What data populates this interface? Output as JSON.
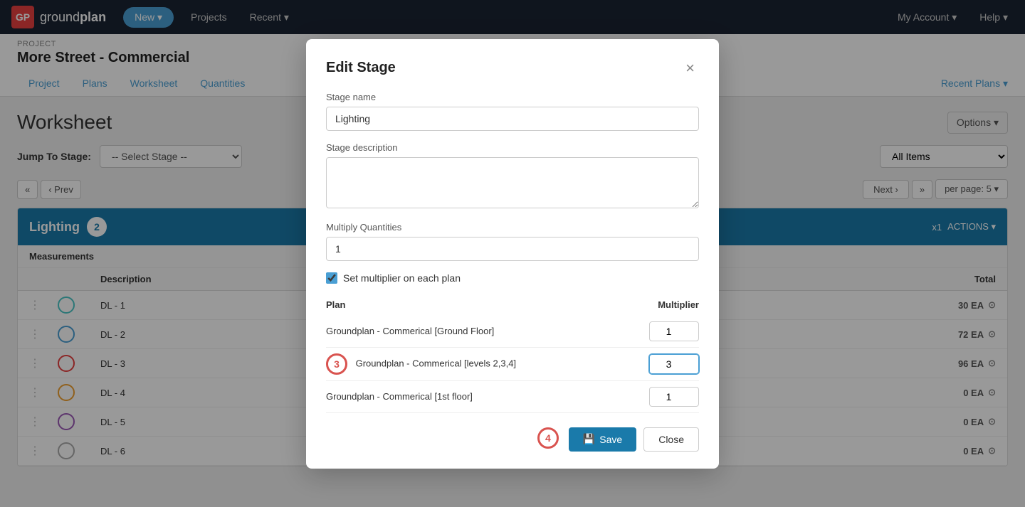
{
  "app": {
    "logo_text_ground": "ground",
    "logo_text_plan": "plan",
    "logo_icon": "GP"
  },
  "top_nav": {
    "new_label": "New ▾",
    "projects_label": "Projects",
    "recent_label": "Recent ▾",
    "account_label": "My Account ▾",
    "help_label": "Help ▾"
  },
  "project": {
    "label": "PROJECT",
    "name": "More Street - Commercial",
    "tabs": [
      "Project",
      "Plans",
      "Worksheet",
      "Quantities"
    ],
    "recent_plans": "Recent Plans ▾"
  },
  "worksheet": {
    "title": "Worksheet",
    "options": "Options ▾",
    "jump_label": "Jump To Stage:",
    "jump_placeholder": "-- Select Stage --",
    "pagination": {
      "prev_skip": "«",
      "prev": "‹ Prev",
      "next": "Next ›",
      "next_skip": "»",
      "per_page": "per page: 5 ▾"
    }
  },
  "stage": {
    "name": "Lighting",
    "badge": "2",
    "x1_label": "x1",
    "actions_label": "ACTIONS ▾",
    "section": "Measurements",
    "col_description": "Description",
    "col_total": "Total",
    "rows": [
      {
        "id": "DL - 1",
        "color": "teal",
        "total": "30 EA"
      },
      {
        "id": "DL - 2",
        "color": "blue",
        "total": "72 EA"
      },
      {
        "id": "DL - 3",
        "color": "red",
        "total": "96 EA"
      },
      {
        "id": "DL - 4",
        "color": "orange",
        "total": "0 EA"
      },
      {
        "id": "DL - 5",
        "color": "purple",
        "total": "0 EA"
      },
      {
        "id": "DL - 6",
        "color": "gray",
        "total": "0 EA"
      }
    ]
  },
  "modal": {
    "title": "Edit Stage",
    "stage_name_label": "Stage name",
    "stage_name_value": "Lighting",
    "stage_desc_label": "Stage description",
    "stage_desc_value": "",
    "multiply_label": "Multiply Quantities",
    "multiply_value": "1",
    "checkbox_label": "Set multiplier on each plan",
    "checkbox_checked": true,
    "plan_col": "Plan",
    "multiplier_col": "Multiplier",
    "plans": [
      {
        "name": "Groundplan - Commerical [Ground Floor]",
        "multiplier": "1",
        "step": null
      },
      {
        "name": "Groundplan - Commerical [levels 2,3,4]",
        "multiplier": "3",
        "step": "3"
      },
      {
        "name": "Groundplan - Commerical [1st floor]",
        "multiplier": "1",
        "step": null
      }
    ],
    "save_label": "Save",
    "close_label": "Close",
    "step4_label": "4"
  }
}
